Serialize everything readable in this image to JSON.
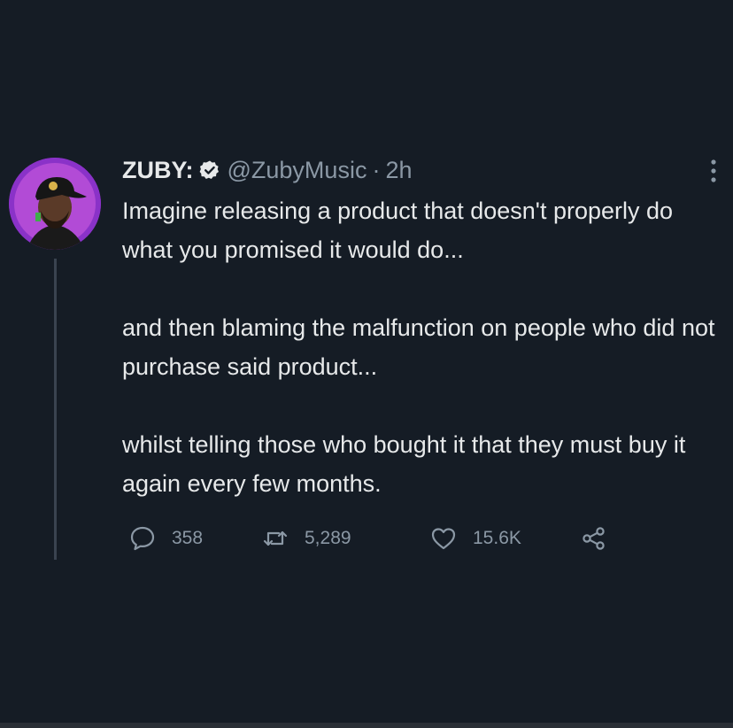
{
  "tweet": {
    "display_name": "ZUBY:",
    "handle": "@ZubyMusic",
    "separator": "·",
    "time": "2h",
    "paragraphs": [
      "Imagine releasing a product that doesn't properly do what you promised it would do...",
      "and then blaming the malfunction on people who did not purchase said product...",
      "whilst telling those who bought it that they must buy it again every few months."
    ],
    "stats": {
      "replies": "358",
      "retweets": "5,289",
      "likes": "15.6K"
    }
  },
  "colors": {
    "background": "#151c25",
    "text": "#e7e9ea",
    "muted": "#8b98a5",
    "avatar_ring": "#8a32c8"
  },
  "icons": [
    "verified-icon",
    "more-icon",
    "reply-icon",
    "retweet-icon",
    "like-icon",
    "share-icon"
  ]
}
